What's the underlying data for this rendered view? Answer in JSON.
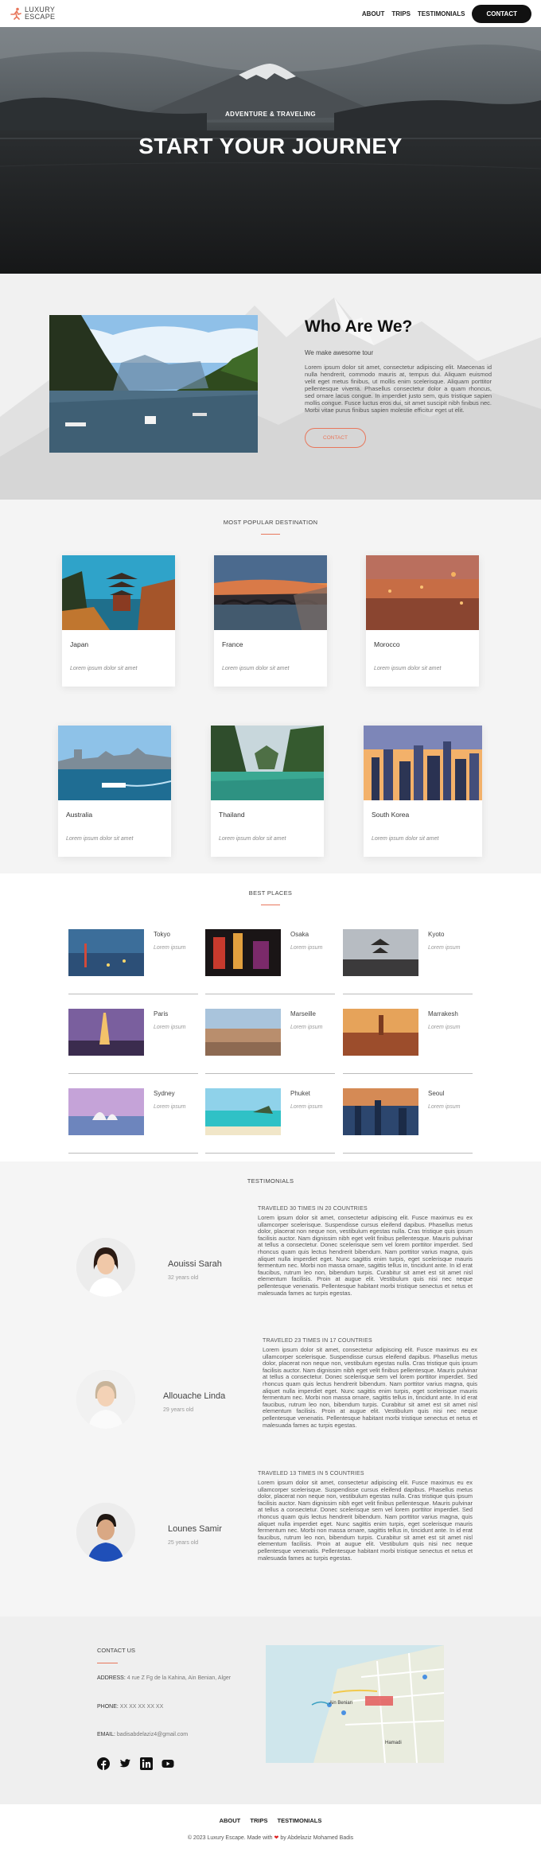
{
  "brand": {
    "line1": "LUXURY",
    "line2": "ESCAPE"
  },
  "nav": {
    "about": "ABOUT",
    "trips": "TRIPS",
    "testimonials": "TESTIMONIALS",
    "contact": "CONTACT"
  },
  "hero": {
    "subtitle": "ADVENTURE & TRAVELING",
    "title": "START YOUR JOURNEY"
  },
  "about": {
    "title": "Who Are We?",
    "lead": "We make awesome tour",
    "body": "Lorem ipsum dolor sit amet, consectetur adipiscing elit. Maecenas id nulla hendrerit, commodo mauris at, tempus dui. Aliquam euismod velit eget metus finibus, ut mollis enim scelerisque. Aliquam porttitor pellentesque viverra. Phasellus consectetur dolor a quam rhoncus, sed ornare lacus congue. In imperdiet justo sem, quis tristique sapien mollis congue. Fusce luctus eros dui, sit amet suscipit nibh finibus nec. Morbi vitae purus finibus sapien molestie efficitur eget ut elit.",
    "button": "CONTACT"
  },
  "destinations": {
    "title": "MOST POPULAR DESTINATION",
    "items": [
      {
        "name": "Japan",
        "desc": "Lorem ipsum dolor sit amet"
      },
      {
        "name": "France",
        "desc": "Lorem ipsum dolor sit amet"
      },
      {
        "name": "Morocco",
        "desc": "Lorem ipsum dolor sit amet"
      },
      {
        "name": "Australia",
        "desc": "Lorem ipsum dolor sit amet"
      },
      {
        "name": "Thailand",
        "desc": "Lorem ipsum dolor sit amet"
      },
      {
        "name": "South Korea",
        "desc": "Lorem ipsum dolor sit amet"
      }
    ]
  },
  "best": {
    "title": "BEST PLACES",
    "items": [
      {
        "name": "Tokyo",
        "desc": "Lorem ipsum"
      },
      {
        "name": "Osaka",
        "desc": "Lorem ipsum"
      },
      {
        "name": "Kyoto",
        "desc": "Lorem ipsum"
      },
      {
        "name": "Paris",
        "desc": "Lorem ipsum"
      },
      {
        "name": "Marseille",
        "desc": "Lorem ipsum"
      },
      {
        "name": "Marrakesh",
        "desc": "Lorem ipsum"
      },
      {
        "name": "Sydney",
        "desc": "Lorem ipsum"
      },
      {
        "name": "Phuket",
        "desc": "Lorem ipsum"
      },
      {
        "name": "Seoul",
        "desc": "Lorem ipsum"
      }
    ]
  },
  "testimonials": {
    "title": "TESTIMONIALS",
    "items": [
      {
        "name": "Aouissi Sarah",
        "age": "32 years old",
        "headline": "TRAVELED 30 TIMES IN 20 COUNTRIES",
        "text": "Lorem ipsum dolor sit amet, consectetur adipiscing elit. Fusce maximus eu ex ullamcorper scelerisque. Suspendisse cursus eleifend dapibus. Phasellus metus dolor, placerat non neque non, vestibulum egestas nulla. Cras tristique quis ipsum facilisis auctor. Nam dignissim nibh eget velit finibus pellentesque. Mauris pulvinar at tellus a consectetur. Donec scelerisque sem vel lorem porttitor imperdiet. Sed rhoncus quam quis lectus hendrerit bibendum. Nam porttitor varius magna, quis aliquet nulla imperdiet eget. Nunc sagittis enim turpis, eget scelerisque mauris fermentum nec. Morbi non massa ornare, sagittis tellus in, tincidunt ante. In id erat faucibus, rutrum leo non, bibendum turpis. Curabitur sit amet est sit amet nisl elementum facilisis. Proin at augue elit. Vestibulum quis nisi nec neque pellentesque venenatis. Pellentesque habitant morbi tristique senectus et netus et malesuada fames ac turpis egestas."
      },
      {
        "name": "Allouache Linda",
        "age": "29 years old",
        "headline": "TRAVELED 23 TIMES IN 17 COUNTRIES",
        "text": "Lorem ipsum dolor sit amet, consectetur adipiscing elit. Fusce maximus eu ex ullamcorper scelerisque. Suspendisse cursus eleifend dapibus. Phasellus metus dolor, placerat non neque non, vestibulum egestas nulla. Cras tristique quis ipsum facilisis auctor. Nam dignissim nibh eget velit finibus pellentesque. Mauris pulvinar at tellus a consectetur. Donec scelerisque sem vel lorem porttitor imperdiet. Sed rhoncus quam quis lectus hendrerit bibendum. Nam porttitor varius magna, quis aliquet nulla imperdiet eget. Nunc sagittis enim turpis, eget scelerisque mauris fermentum nec. Morbi non massa ornare, sagittis tellus in, tincidunt ante. In id erat faucibus, rutrum leo non, bibendum turpis. Curabitur sit amet est sit amet nisl elementum facilisis. Proin at augue elit. Vestibulum quis nisi nec neque pellentesque venenatis. Pellentesque habitant morbi tristique senectus et netus et malesuada fames ac turpis egestas."
      },
      {
        "name": "Lounes Samir",
        "age": "25 years old",
        "headline": "TRAVELED 13 TIMES IN 5 COUNTRIES",
        "text": "Lorem ipsum dolor sit amet, consectetur adipiscing elit. Fusce maximus eu ex ullamcorper scelerisque. Suspendisse cursus eleifend dapibus. Phasellus metus dolor, placerat non neque non, vestibulum egestas nulla. Cras tristique quis ipsum facilisis auctor. Nam dignissim nibh eget velit finibus pellentesque. Mauris pulvinar at tellus a consectetur. Donec scelerisque sem vel lorem porttitor imperdiet. Sed rhoncus quam quis lectus hendrerit bibendum. Nam porttitor varius magna, quis aliquet nulla imperdiet eget. Nunc sagittis enim turpis, eget scelerisque mauris fermentum nec. Morbi non massa ornare, sagittis tellus in, tincidunt ante. In id erat faucibus, rutrum leo non, bibendum turpis. Curabitur sit amet est sit amet nisl elementum facilisis. Proin at augue elit. Vestibulum quis nisi nec neque pellentesque venenatis. Pellentesque habitant morbi tristique senectus et netus et malesuada fames ac turpis egestas."
      }
    ]
  },
  "contact": {
    "title": "CONTACT US",
    "address_label": "ADDRESS:",
    "address": "4 rue Z Fg de la Kahina, Ain Benian, Alger",
    "phone_label": "PHONE:",
    "phone": "XX XX XX XX XX",
    "email_label": "EMAIL:",
    "email": "badisabdelaziz4@gmail.com",
    "socials": [
      "facebook-icon",
      "twitter-icon",
      "linkedin-icon",
      "youtube-icon"
    ],
    "map_labels": [
      "Ain Benian",
      "Hamadi"
    ]
  },
  "footer": {
    "about": "ABOUT",
    "trips": "TRIPS",
    "testimonials": "TESTIMONIALS",
    "copy_prefix": "© 2023 Luxury Escape. Made with",
    "copy_suffix": "by Abdelaziz Mohamed Badis"
  },
  "colors": {
    "accent": "#e8775c",
    "dark": "#111111"
  }
}
